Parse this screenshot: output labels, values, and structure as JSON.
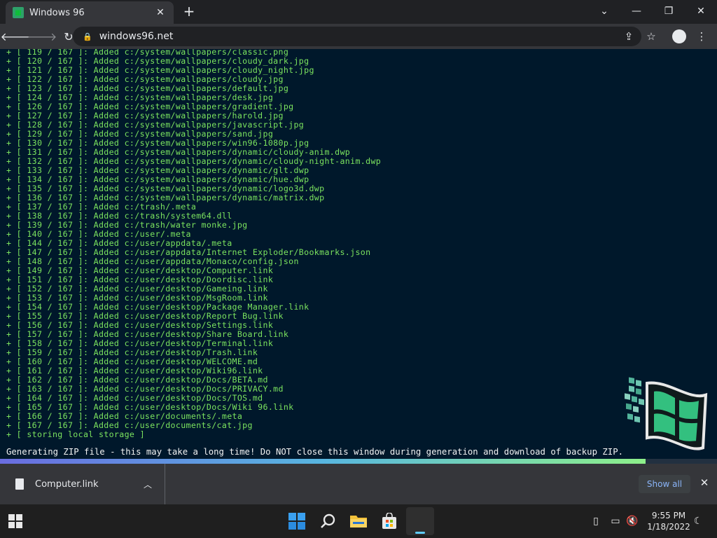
{
  "browser": {
    "tab_title": "Windows 96",
    "url": "windows96.net"
  },
  "terminal": {
    "lines": [
      "+ [ 119 / 167 ]: Added c:/system/wallpapers/classic.png",
      "+ [ 120 / 167 ]: Added c:/system/wallpapers/cloudy_dark.jpg",
      "+ [ 121 / 167 ]: Added c:/system/wallpapers/cloudy_night.jpg",
      "+ [ 122 / 167 ]: Added c:/system/wallpapers/cloudy.jpg",
      "+ [ 123 / 167 ]: Added c:/system/wallpapers/default.jpg",
      "+ [ 124 / 167 ]: Added c:/system/wallpapers/desk.jpg",
      "+ [ 126 / 167 ]: Added c:/system/wallpapers/gradient.jpg",
      "+ [ 127 / 167 ]: Added c:/system/wallpapers/harold.jpg",
      "+ [ 128 / 167 ]: Added c:/system/wallpapers/javascript.jpg",
      "+ [ 129 / 167 ]: Added c:/system/wallpapers/sand.jpg",
      "+ [ 130 / 167 ]: Added c:/system/wallpapers/win96-1080p.jpg",
      "+ [ 131 / 167 ]: Added c:/system/wallpapers/dynamic/cloudy-anim.dwp",
      "+ [ 132 / 167 ]: Added c:/system/wallpapers/dynamic/cloudy-night-anim.dwp",
      "+ [ 133 / 167 ]: Added c:/system/wallpapers/dynamic/glt.dwp",
      "+ [ 134 / 167 ]: Added c:/system/wallpapers/dynamic/hue.dwp",
      "+ [ 135 / 167 ]: Added c:/system/wallpapers/dynamic/logo3d.dwp",
      "+ [ 136 / 167 ]: Added c:/system/wallpapers/dynamic/matrix.dwp",
      "+ [ 137 / 167 ]: Added c:/trash/.meta",
      "+ [ 138 / 167 ]: Added c:/trash/system64.dll",
      "+ [ 139 / 167 ]: Added c:/trash/water monke.jpg",
      "+ [ 140 / 167 ]: Added c:/user/.meta",
      "+ [ 144 / 167 ]: Added c:/user/appdata/.meta",
      "+ [ 147 / 167 ]: Added c:/user/appdata/Internet Exploder/Bookmarks.json",
      "+ [ 148 / 167 ]: Added c:/user/appdata/Monaco/config.json",
      "+ [ 149 / 167 ]: Added c:/user/desktop/Computer.link",
      "+ [ 151 / 167 ]: Added c:/user/desktop/Doordisc.link",
      "+ [ 152 / 167 ]: Added c:/user/desktop/Gameing.link",
      "+ [ 153 / 167 ]: Added c:/user/desktop/MsgRoom.link",
      "+ [ 154 / 167 ]: Added c:/user/desktop/Package Manager.link",
      "+ [ 155 / 167 ]: Added c:/user/desktop/Report Bug.link",
      "+ [ 156 / 167 ]: Added c:/user/desktop/Settings.link",
      "+ [ 157 / 167 ]: Added c:/user/desktop/Share Board.link",
      "+ [ 158 / 167 ]: Added c:/user/desktop/Terminal.link",
      "+ [ 159 / 167 ]: Added c:/user/desktop/Trash.link",
      "+ [ 160 / 167 ]: Added c:/user/desktop/WELCOME.md",
      "+ [ 161 / 167 ]: Added c:/user/desktop/Wiki96.link",
      "+ [ 162 / 167 ]: Added c:/user/desktop/Docs/BETA.md",
      "+ [ 163 / 167 ]: Added c:/user/desktop/Docs/PRIVACY.md",
      "+ [ 164 / 167 ]: Added c:/user/desktop/Docs/TOS.md",
      "+ [ 165 / 167 ]: Added c:/user/desktop/Docs/Wiki 96.link",
      "+ [ 166 / 167 ]: Added c:/user/documents/.meta",
      "+ [ 167 / 167 ]: Added c:/user/documents/cat.jpg",
      "+ [ storing local storage ]"
    ],
    "status": "Generating ZIP file - this may take a long time! Do NOT close this window during generation and download of backup ZIP.",
    "progress": 0.9,
    "text_color": "#7be35f",
    "background_color": "#00182b"
  },
  "downloads_bar": {
    "file_name": "Computer.link",
    "show_all_label": "Show all"
  },
  "taskbar": {
    "time": "9:55 PM",
    "date": "1/18/2022"
  }
}
